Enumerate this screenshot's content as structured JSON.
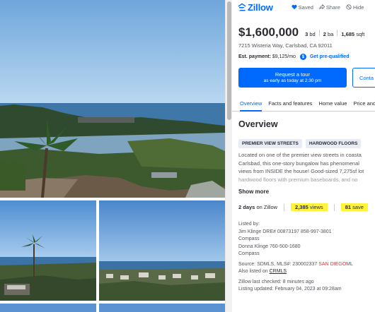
{
  "brand": {
    "name": "Zillow",
    "color": "#006aff"
  },
  "header_actions": [
    {
      "label": "Saved",
      "icon": "heart-icon"
    },
    {
      "label": "Share",
      "icon": "share-icon"
    },
    {
      "label": "Hide",
      "icon": "hide-icon"
    }
  ],
  "listing": {
    "price": "$1,600,000",
    "beds_value": "3",
    "beds_unit": "bd",
    "baths_value": "2",
    "baths_unit": "ba",
    "sqft_value": "1,685",
    "sqft_unit": "sqft",
    "address": "7215 Wisteria Way, Carlsbad, CA 92011",
    "est_payment_label": "Est. payment:",
    "est_payment_value": "$9,125/mo",
    "payment_badge": "$",
    "prequal_label": "Get pre-qualified"
  },
  "buttons": {
    "request_tour": "Request a tour",
    "request_tour_sub": "as early as today at 2:30 pm",
    "contact": "Conta"
  },
  "tabs": [
    "Overview",
    "Facts and features",
    "Home value",
    "Price and"
  ],
  "overview": {
    "title": "Overview",
    "chips": [
      "PREMIER VIEW STREETS",
      "HARDWOOD FLOORS"
    ],
    "description": [
      "Located on one of the premier view streets in coasta",
      "Carlsbad, this one-story bungalow has phenomenal",
      "views from INSIDE the house! Good-sized 7,275sf lot",
      "hardwood floors with premium baseboards, and no"
    ],
    "show_more": "Show more"
  },
  "stats": {
    "days_value": "2 days",
    "days_label": "on Zillow",
    "views_value": "2,385",
    "views_label": "views",
    "saves_value": "81",
    "saves_label": "save"
  },
  "listed_by": {
    "heading": "Listed by:",
    "agent1": "Jim Klinge DRE# 00873197 858-997-3801",
    "broker1": "Compass",
    "agent2": "Donna Klinge 760-500-1680",
    "broker2": "Compass"
  },
  "source": {
    "prefix": "Source: SDMLS,  MLS#: 230002337",
    "sd_part": "SAN DIEGO",
    "ml_part": "ML",
    "also_listed_label": "Also listed on",
    "also_listed_link": "CRMLS"
  },
  "timestamps": {
    "checked": "Zillow last checked: 8 minutes ago",
    "updated": "Listing updated: February 04, 2023 at 09:28am"
  }
}
